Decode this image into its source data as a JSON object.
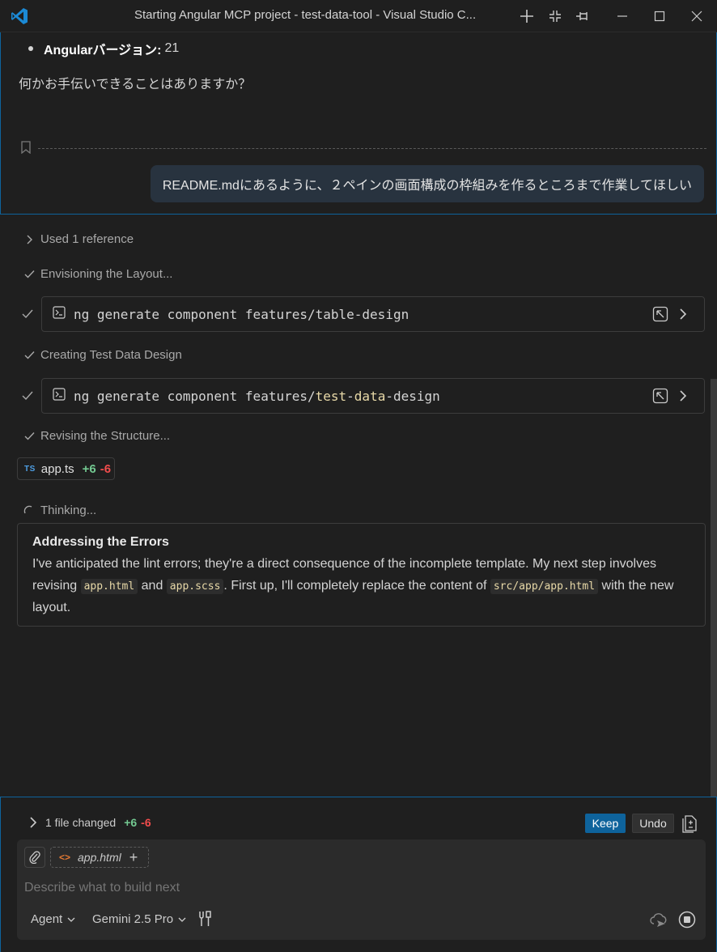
{
  "window": {
    "title": "Starting Angular MCP project - test-data-tool - Visual Studio C..."
  },
  "history": {
    "bullet_label": "Angularバージョン:",
    "bullet_value": "21",
    "assistant_question": "何かお手伝いできることはありますか？",
    "user_message": "README.mdにあるように、２ペインの画面構成の枠組みを作るところまで作業してほしい"
  },
  "response": {
    "references": "Used 1 reference",
    "step1": "Envisioning the Layout...",
    "command1": "ng generate component features/table-design",
    "step2": "Creating Test Data Design",
    "command2_prefix": "ng generate component features/",
    "command2_hl1": "test",
    "command2_sep1": "-",
    "command2_hl2": "data",
    "command2_suffix": "-design",
    "step3": "Revising the Structure...",
    "edit_file": {
      "badge": "TS",
      "name": "app.ts",
      "added": "+6",
      "removed": "-6"
    },
    "thinking_label": "Thinking...",
    "thinking": {
      "heading": "Addressing the Errors",
      "text1": "I've anticipated the lint errors; they're a direct consequence of the incomplete template. My next step involves revising ",
      "code1": "app.html",
      "text2": " and ",
      "code2": "app.scss",
      "text3": ". First up, I'll completely replace the content of ",
      "code3": "src/app/app.html",
      "text4": " with the new layout."
    }
  },
  "changes": {
    "summary": "1 file changed",
    "added": "+6",
    "removed": "-6",
    "keep_label": "Keep",
    "undo_label": "Undo"
  },
  "input": {
    "context_file": "app.html",
    "context_icon": "<>",
    "placeholder": "Describe what to build next",
    "mode": "Agent",
    "model": "Gemini 2.5 Pro"
  },
  "colors": {
    "accent": "#0e639c",
    "added": "#73c991",
    "removed": "#f14c4c",
    "background": "#1f1f1f"
  },
  "icons": [
    "vscode-logo-icon",
    "new-chat-icon",
    "collapse-icon",
    "pin-icon",
    "minimize-icon",
    "maximize-icon",
    "close-icon",
    "bookmark-icon",
    "chevron-right-icon",
    "check-icon",
    "terminal-icon",
    "open-in-terminal-icon",
    "loading-spinner-icon",
    "attach-icon",
    "html-file-icon",
    "add-context-icon",
    "chevron-down-icon",
    "tools-icon",
    "send-cloud-icon",
    "stop-icon",
    "review-changes-icon"
  ]
}
